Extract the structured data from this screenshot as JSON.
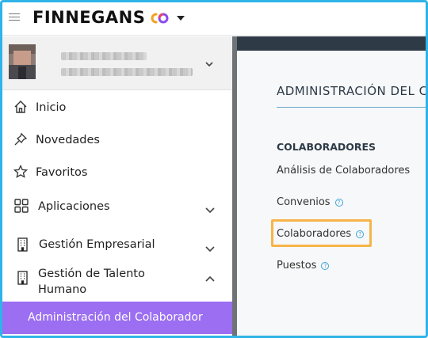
{
  "header": {
    "brand": "FINNEGANS",
    "colors": {
      "logo_orange": "#f5a020",
      "logo_purple": "#8a4cf0",
      "frame": "#2fb3e8"
    }
  },
  "sidebar": {
    "items": [
      {
        "label": "Inicio",
        "icon": "home-icon"
      },
      {
        "label": "Novedades",
        "icon": "pin-icon"
      },
      {
        "label": "Favoritos",
        "icon": "star-icon"
      },
      {
        "label": "Aplicaciones",
        "icon": "apps-grid-icon"
      },
      {
        "label": "Gestión Empresarial",
        "icon": "building-icon"
      },
      {
        "label_line1": "Gestión de Talento",
        "label_line2": "Humano",
        "icon": "building-icon"
      }
    ],
    "active_item": "Administración del Colaborador",
    "active_color": "#9b6ef2"
  },
  "main": {
    "title": "ADMINISTRACIÓN DEL CO",
    "section": "COLABORADORES",
    "links": [
      {
        "label": "Análisis de Colaboradores"
      },
      {
        "label": "Convenios"
      },
      {
        "label": "Colaboradores"
      },
      {
        "label": "Puestos"
      }
    ],
    "help_glyph": "?"
  }
}
